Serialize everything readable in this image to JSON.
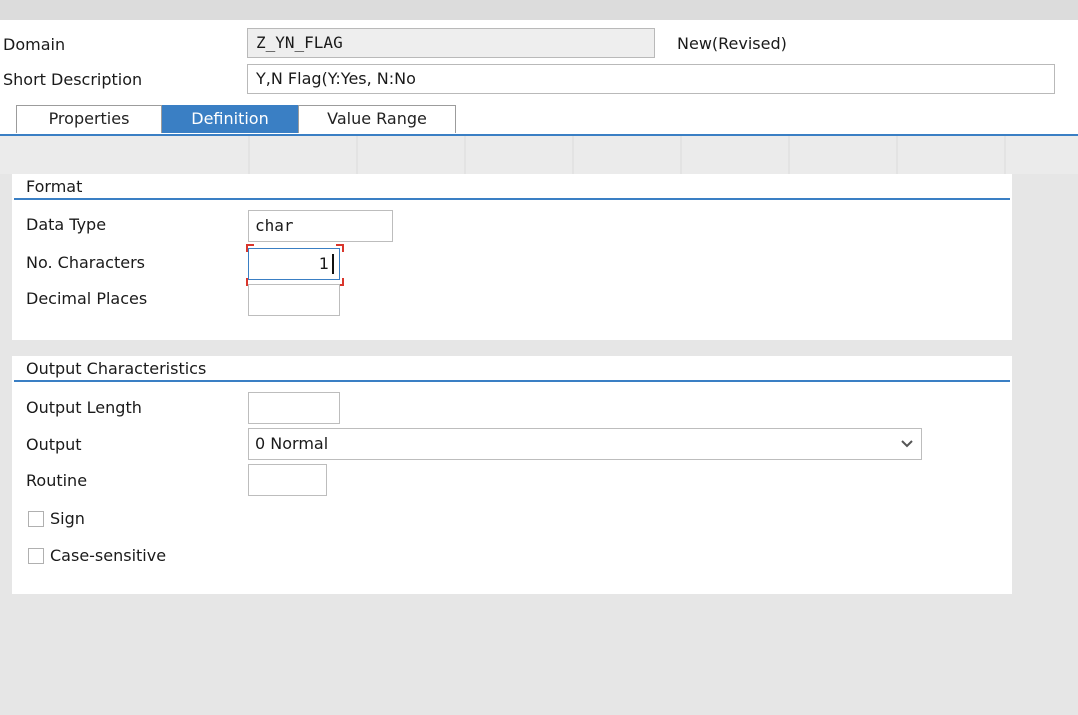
{
  "header": {
    "domain_label": "Domain",
    "domain_value": "Z_YN_FLAG",
    "status": "New(Revised)",
    "short_desc_label": "Short Description",
    "short_desc_value": "Y,N Flag(Y:Yes, N:No"
  },
  "tabs": [
    {
      "label": "Properties",
      "active": false
    },
    {
      "label": "Definition",
      "active": true
    },
    {
      "label": "Value Range",
      "active": false
    }
  ],
  "format": {
    "title": "Format",
    "data_type_label": "Data Type",
    "data_type_value": "char",
    "no_chars_label": "No. Characters",
    "no_chars_value": "1",
    "decimal_label": "Decimal Places",
    "decimal_value": ""
  },
  "output": {
    "title": "Output Characteristics",
    "length_label": "Output Length",
    "length_value": "",
    "output_label": "Output",
    "output_value": "0 Normal",
    "routine_label": "Routine",
    "routine_value": "",
    "sign_label": "Sign",
    "sign_checked": false,
    "case_label": "Case-sensitive",
    "case_checked": false
  },
  "colors": {
    "accent": "#3a7fc4",
    "focus": "#d9362c"
  },
  "icons": {
    "output_dropdown": "chevron-down-icon"
  }
}
